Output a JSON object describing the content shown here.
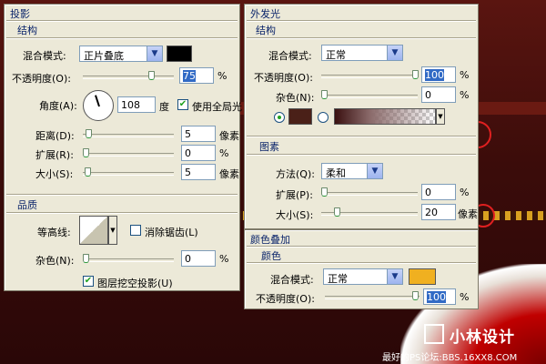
{
  "drop_shadow": {
    "title": "投影",
    "structure_label": "结构",
    "blend_mode_label": "混合模式:",
    "blend_mode_value": "正片叠底",
    "blend_color": "#000000",
    "opacity_label": "不透明度(O):",
    "opacity_value": "75",
    "opacity_level": 0.75,
    "percent": "%",
    "angle_label": "角度(A):",
    "angle_value": "108",
    "degree_label": "度",
    "use_global_light_label": "使用全局光",
    "use_global_light_checked": true,
    "distance_label": "距离(D):",
    "distance_value": "5",
    "spread_label": "扩展(R):",
    "spread_value": "0",
    "size_label": "大小(S):",
    "size_value": "5",
    "pixel_unit": "像素",
    "quality_label": "品质",
    "contour_label": "等高线:",
    "anti_alias_label": "消除锯齿(L)",
    "noise_label": "杂色(N):",
    "noise_value": "0",
    "knockout_label": "图层挖空投影(U)",
    "knockout_checked": true
  },
  "outer_glow": {
    "title": "外发光",
    "structure_label": "结构",
    "blend_mode_label": "混合模式:",
    "blend_mode_value": "正常",
    "opacity_label": "不透明度(O):",
    "opacity_value": "100",
    "opacity_level": 1.0,
    "percent": "%",
    "noise_label": "杂色(N):",
    "noise_value": "0",
    "solid_color": "#4a2018",
    "elements_label": "图素",
    "technique_label": "方法(Q):",
    "technique_value": "柔和",
    "spread_label": "扩展(P):",
    "spread_value": "0",
    "size_label": "大小(S):",
    "size_value": "20",
    "pixel_unit": "像素"
  },
  "color_overlay": {
    "title": "颜色叠加",
    "color_label": "颜色",
    "blend_mode_label": "混合模式:",
    "blend_mode_value": "正常",
    "overlay_color": "#f0b020",
    "opacity_label": "不透明度(O):",
    "opacity_value": "100",
    "opacity_level": 1.0,
    "percent": "%"
  },
  "watermark": {
    "logo_text": "小林设计",
    "forum_text": "最好的PS论坛:BBS.16XX8.COM"
  }
}
